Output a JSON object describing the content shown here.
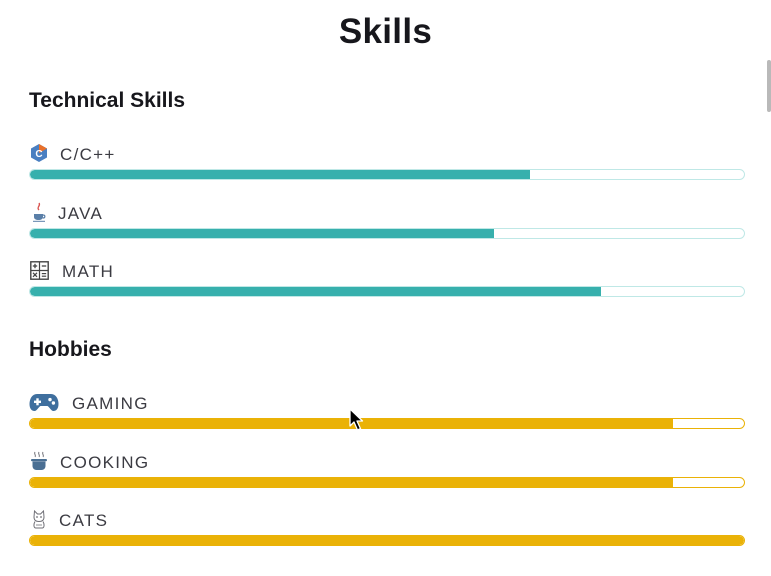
{
  "page": {
    "title": "Skills",
    "accent_teal": "#37b0ad",
    "accent_gold": "#eab207"
  },
  "technical": {
    "heading": "Technical Skills",
    "items": [
      {
        "label": "C/C++",
        "icon": "c-language-icon",
        "level_percent": 70
      },
      {
        "label": "JAVA",
        "icon": "java-icon",
        "level_percent": 65
      },
      {
        "label": "MATH",
        "icon": "calculator-icon",
        "level_percent": 80
      }
    ]
  },
  "hobbies": {
    "heading": "Hobbies",
    "items": [
      {
        "label": "GAMING",
        "icon": "gamepad-icon",
        "level_percent": 90
      },
      {
        "label": "COOKING",
        "icon": "cooking-pot-icon",
        "level_percent": 90
      },
      {
        "label": "CATS",
        "icon": "cat-icon",
        "level_percent": 100
      }
    ]
  }
}
